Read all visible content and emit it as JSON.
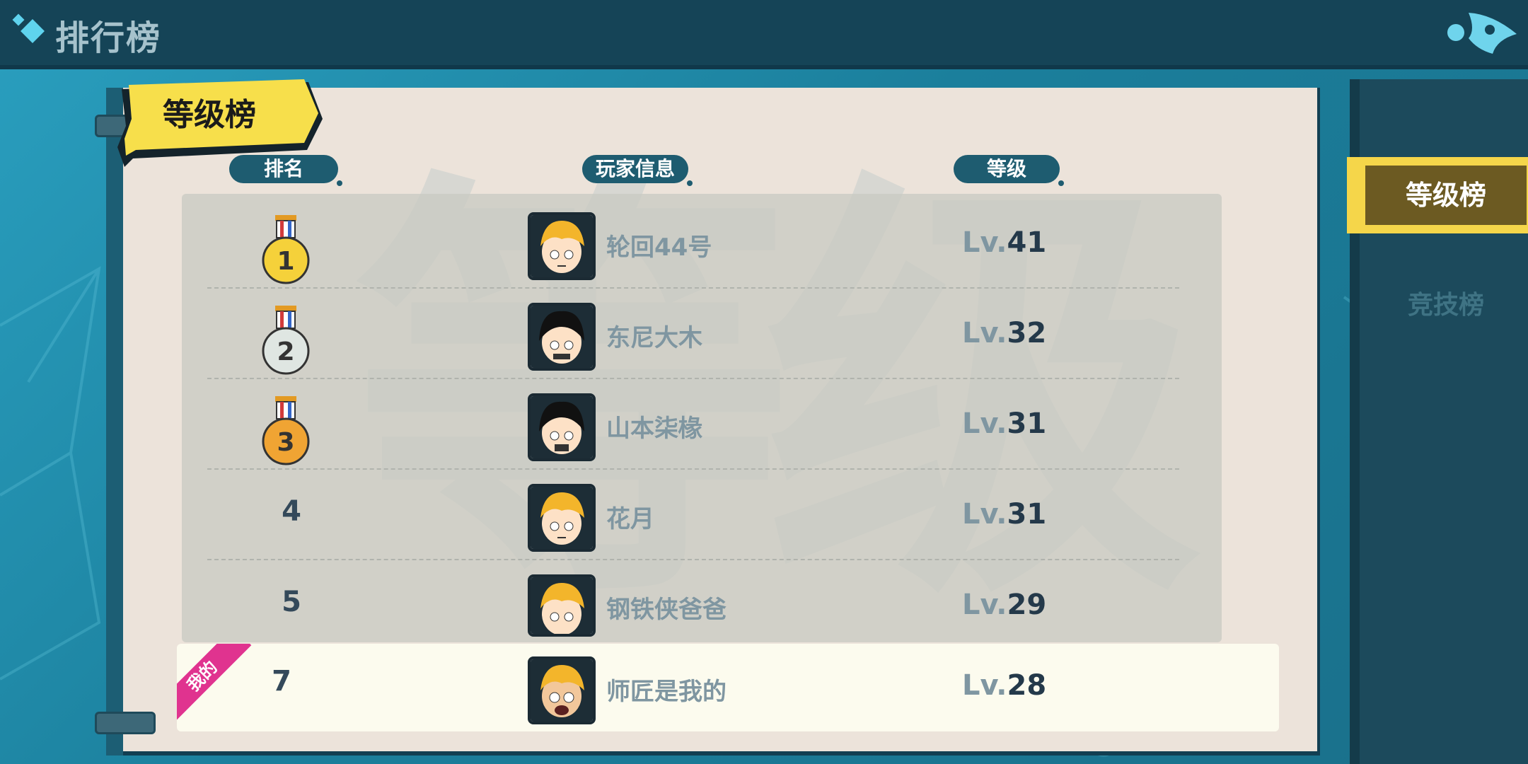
{
  "header": {
    "title": "排行榜"
  },
  "badge": {
    "label": "等级榜"
  },
  "columns": {
    "rank": "排名",
    "player": "玩家信息",
    "level": "等级"
  },
  "watermark": "等级",
  "rows": [
    {
      "rank": "1",
      "medal_color": "#f5d13a",
      "name": "轮回44号",
      "lv_prefix": "Lv.",
      "level": "41",
      "hair": "#f3b52b"
    },
    {
      "rank": "2",
      "medal_color": "#dfe6e2",
      "name": "东尼大木",
      "lv_prefix": "Lv.",
      "level": "32",
      "hair": "#111111"
    },
    {
      "rank": "3",
      "medal_color": "#f0a433",
      "name": "山本柒椽",
      "lv_prefix": "Lv.",
      "level": "31",
      "hair": "#111111"
    },
    {
      "rank": "4",
      "name": "花月",
      "lv_prefix": "Lv.",
      "level": "31",
      "hair": "#f3b52b"
    },
    {
      "rank": "5",
      "name": "钢铁侠爸爸",
      "lv_prefix": "Lv.",
      "level": "29",
      "hair": "#f3b52b"
    }
  ],
  "me": {
    "tag": "我的",
    "rank": "7",
    "name": "师匠是我的",
    "lv_prefix": "Lv.",
    "level": "28",
    "hair": "#f3b52b"
  },
  "tabs": [
    {
      "label": "等级榜",
      "active": true
    },
    {
      "label": "竞技榜",
      "active": false
    }
  ]
}
